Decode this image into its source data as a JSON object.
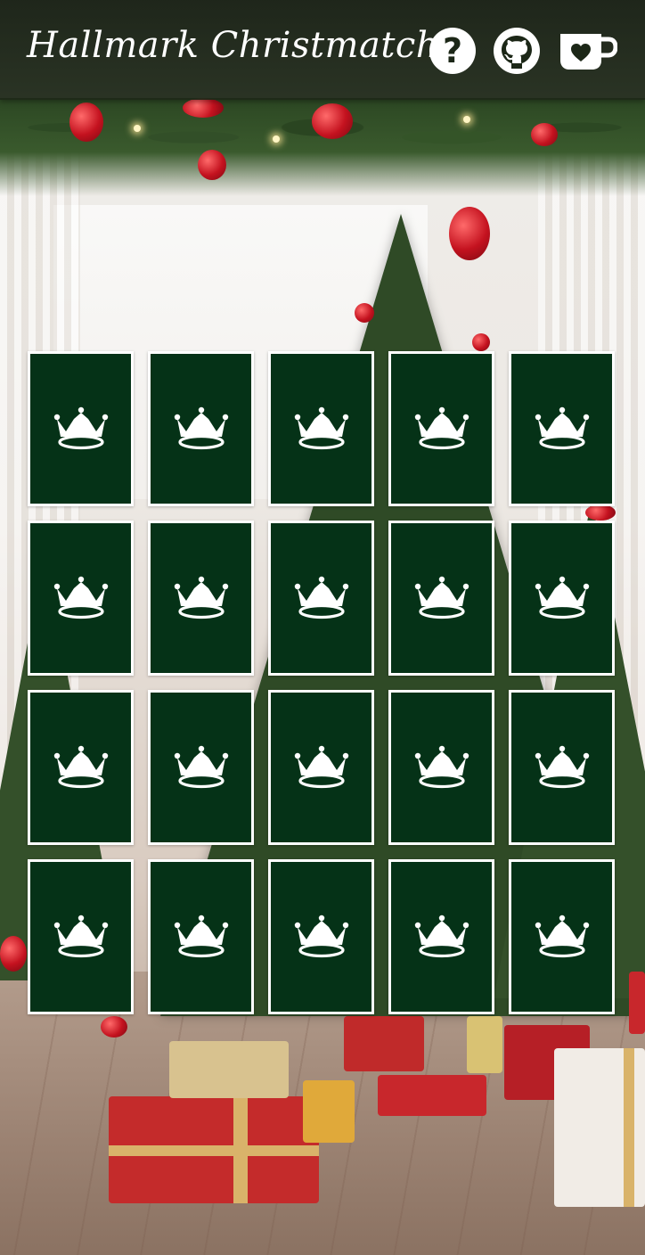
{
  "header": {
    "title": "Hallmark Christmatch",
    "buttons": [
      {
        "name": "help-button",
        "icon": "question-icon"
      },
      {
        "name": "github-button",
        "icon": "github-icon"
      },
      {
        "name": "coffee-button",
        "icon": "coffee-heart-icon"
      }
    ]
  },
  "board": {
    "rows": 4,
    "columns": 5,
    "cards": [
      {
        "face": "down",
        "icon": "crown-icon"
      },
      {
        "face": "down",
        "icon": "crown-icon"
      },
      {
        "face": "down",
        "icon": "crown-icon"
      },
      {
        "face": "down",
        "icon": "crown-icon"
      },
      {
        "face": "down",
        "icon": "crown-icon"
      },
      {
        "face": "down",
        "icon": "crown-icon"
      },
      {
        "face": "down",
        "icon": "crown-icon"
      },
      {
        "face": "down",
        "icon": "crown-icon"
      },
      {
        "face": "down",
        "icon": "crown-icon"
      },
      {
        "face": "down",
        "icon": "crown-icon"
      },
      {
        "face": "down",
        "icon": "crown-icon"
      },
      {
        "face": "down",
        "icon": "crown-icon"
      },
      {
        "face": "down",
        "icon": "crown-icon"
      },
      {
        "face": "down",
        "icon": "crown-icon"
      },
      {
        "face": "down",
        "icon": "crown-icon"
      },
      {
        "face": "down",
        "icon": "crown-icon"
      },
      {
        "face": "down",
        "icon": "crown-icon"
      },
      {
        "face": "down",
        "icon": "crown-icon"
      },
      {
        "face": "down",
        "icon": "crown-icon"
      },
      {
        "face": "down",
        "icon": "crown-icon"
      }
    ]
  },
  "colors": {
    "card_back": "#053217",
    "card_border": "#ffffff",
    "header_bg": "#1c2717",
    "icon": "#ffffff"
  },
  "background": {
    "icon": "christmas-tree-scene"
  }
}
